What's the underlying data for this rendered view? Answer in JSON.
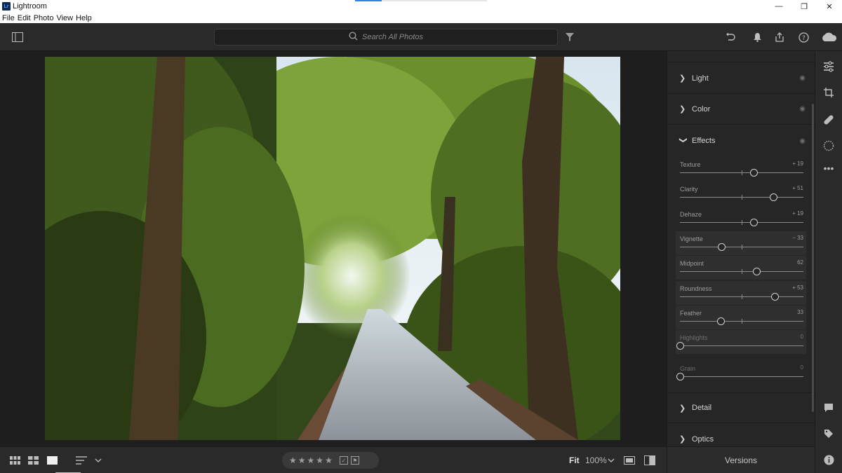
{
  "window": {
    "title": "Lightroom",
    "logo_text": "Lr",
    "minimize": "—",
    "maximize": "❐",
    "close": "✕"
  },
  "menu": [
    "File",
    "Edit",
    "Photo",
    "View",
    "Help"
  ],
  "search": {
    "placeholder": "Search All Photos"
  },
  "edit_panel": {
    "sections_top": [
      {
        "label": "Light"
      },
      {
        "label": "Color"
      },
      {
        "label": "Effects"
      }
    ],
    "effects_sliders": [
      {
        "label": "Texture",
        "value": "+ 19",
        "level": 0.595,
        "highlight": false,
        "dim": false
      },
      {
        "label": "Clarity",
        "value": "+ 51",
        "level": 0.755,
        "highlight": false,
        "dim": false
      },
      {
        "label": "Dehaze",
        "value": "+ 19",
        "level": 0.595,
        "highlight": false,
        "dim": false
      },
      {
        "label": "Vignette",
        "value": "− 33",
        "level": 0.335,
        "highlight": true,
        "dim": false
      },
      {
        "label": "Midpoint",
        "value": "62",
        "level": 0.62,
        "highlight": true,
        "dim": false
      },
      {
        "label": "Roundness",
        "value": "+ 53",
        "level": 0.765,
        "highlight": true,
        "dim": false
      },
      {
        "label": "Feather",
        "value": "33",
        "level": 0.33,
        "highlight": true,
        "dim": false
      },
      {
        "label": "Highlights",
        "value": "0",
        "level": 0.0,
        "highlight": true,
        "dim": true
      },
      {
        "label": "Grain",
        "value": "0",
        "level": 0.0,
        "highlight": false,
        "dim": true
      }
    ],
    "sections_bottom": [
      {
        "label": "Detail"
      },
      {
        "label": "Optics"
      }
    ]
  },
  "bottom": {
    "fit": "Fit",
    "zoom": "100%",
    "versions": "Versions",
    "stars": [
      "★",
      "★",
      "★",
      "★",
      "★"
    ]
  }
}
